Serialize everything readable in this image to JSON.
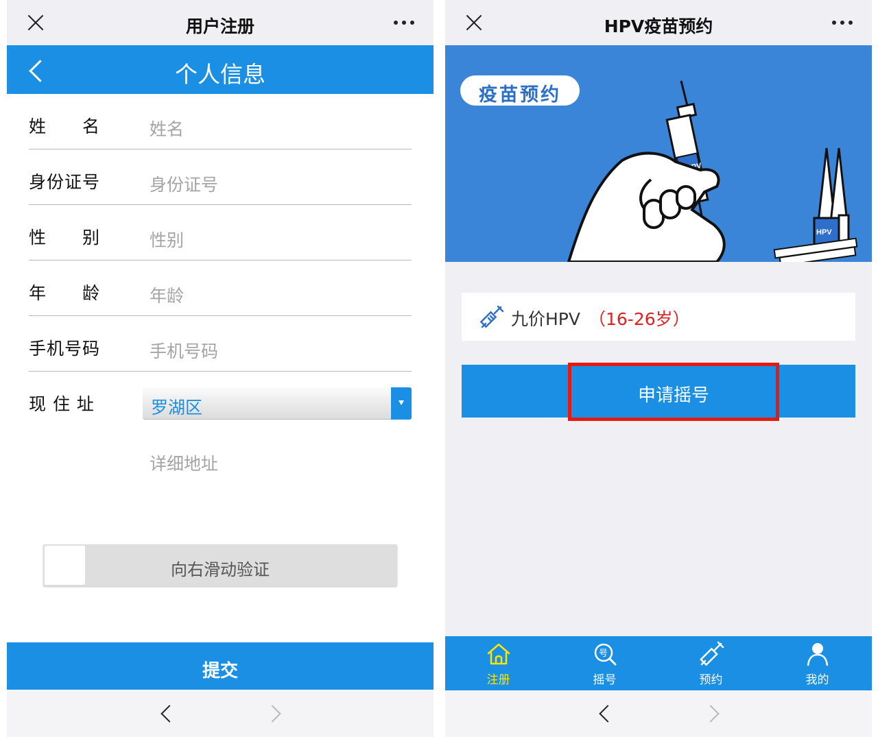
{
  "left_screen": {
    "window_title": "用户注册",
    "header_title": "个人信息",
    "fields": [
      {
        "label": "姓　　名",
        "placeholder": "姓名"
      },
      {
        "label": "身份证号",
        "placeholder": "身份证号"
      },
      {
        "label": "性　　别",
        "placeholder": "性别"
      },
      {
        "label": "年　　龄",
        "placeholder": "年龄"
      },
      {
        "label": "手机号码",
        "placeholder": "手机号码"
      }
    ],
    "address": {
      "label": "现 住 址",
      "district_value": "罗湖区",
      "detail_placeholder": "详细地址"
    },
    "slider_text": "向右滑动验证",
    "submit_label": "提交"
  },
  "right_screen": {
    "window_title": "HPV疫苗预约",
    "banner": {
      "badge_text": "疫苗预约",
      "syringe_label": "HPV",
      "vial_label": "HPV"
    },
    "vaccine": {
      "name": "九价HPV",
      "age_range": "（16-26岁）"
    },
    "apply_button": "申请摇号",
    "tabs": [
      {
        "label": "注册",
        "icon": "home-icon",
        "active": true
      },
      {
        "label": "摇号",
        "icon": "lottery-search-icon",
        "active": false
      },
      {
        "label": "预约",
        "icon": "syringe-icon",
        "active": false
      },
      {
        "label": "我的",
        "icon": "user-icon",
        "active": false
      }
    ]
  },
  "colors": {
    "primary_blue": "#1a8fe3",
    "banner_blue": "#3a85d8",
    "highlight_red": "#e31b12",
    "active_tab_yellow": "#ffe600",
    "age_red": "#e02020"
  }
}
